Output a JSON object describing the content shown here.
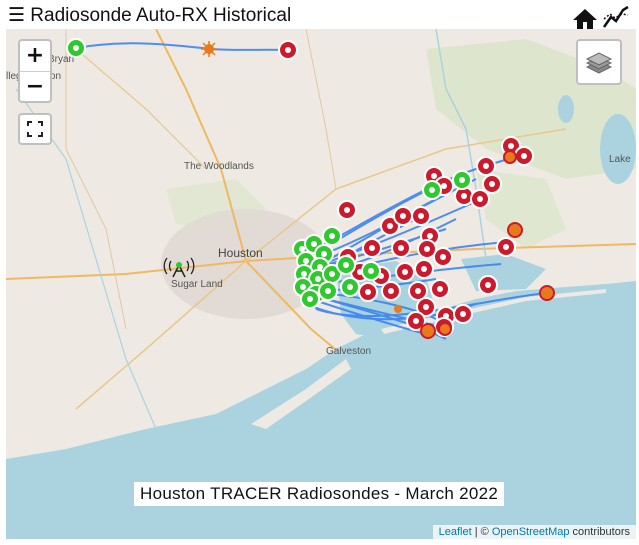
{
  "header": {
    "menu_label": "☰ Radiosonde Auto-RX Historical",
    "home_icon": "home-icon",
    "trend_icon": "line-chart-icon"
  },
  "map": {
    "zoom_in": "+",
    "zoom_out": "−",
    "fullscreen_icon": "fullscreen-icon",
    "layers_icon": "layers-icon",
    "caption": "Houston TRACER Radiosondes - March 2022",
    "attribution": {
      "leaflet": "Leaflet",
      "separator": " | © ",
      "osm": "OpenStreetMap",
      "suffix": " contributors"
    },
    "places": {
      "bryan": "Bryan",
      "college_station": "llege Station",
      "woodlands": "The Woodlands",
      "houston": "Houston",
      "sugar_land": "Sugar Land",
      "galveston": "Galveston",
      "lake": "Lake"
    },
    "colors": {
      "track": "#3d83f0",
      "launch_marker": "#2fc82f",
      "landing_marker": "#cc1a2c",
      "burst_marker": "#e87a1c",
      "water": "#aad3df",
      "land": "#eeeae3"
    }
  }
}
